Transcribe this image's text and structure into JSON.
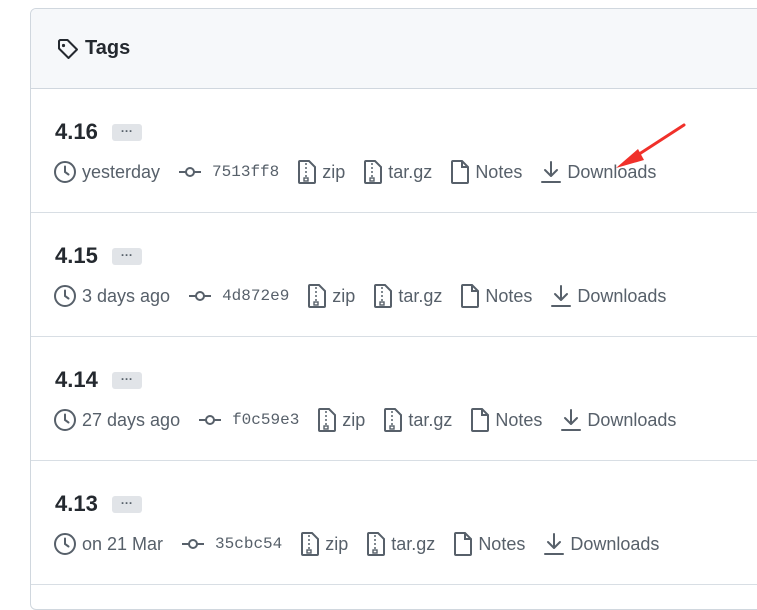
{
  "header": {
    "title": "Tags"
  },
  "tags": [
    {
      "name": "4.16",
      "ellipsis": "···",
      "date": "yesterday",
      "sha": "7513ff8",
      "zip": "zip",
      "targz": "tar.gz",
      "notes": "Notes",
      "downloads": "Downloads"
    },
    {
      "name": "4.15",
      "ellipsis": "···",
      "date": "3 days ago",
      "sha": "4d872e9",
      "zip": "zip",
      "targz": "tar.gz",
      "notes": "Notes",
      "downloads": "Downloads"
    },
    {
      "name": "4.14",
      "ellipsis": "···",
      "date": "27 days ago",
      "sha": "f0c59e3",
      "zip": "zip",
      "targz": "tar.gz",
      "notes": "Notes",
      "downloads": "Downloads"
    },
    {
      "name": "4.13",
      "ellipsis": "···",
      "date": "on 21 Mar",
      "sha": "35cbc54",
      "zip": "zip",
      "targz": "tar.gz",
      "notes": "Notes",
      "downloads": "Downloads"
    }
  ],
  "colors": {
    "annotation_arrow": "#f0302a",
    "text_muted": "#57606a",
    "text_primary": "#24292f"
  },
  "icons": [
    "tag-icon",
    "clock-icon",
    "commit-icon",
    "file-zip-icon",
    "file-icon",
    "download-icon"
  ]
}
